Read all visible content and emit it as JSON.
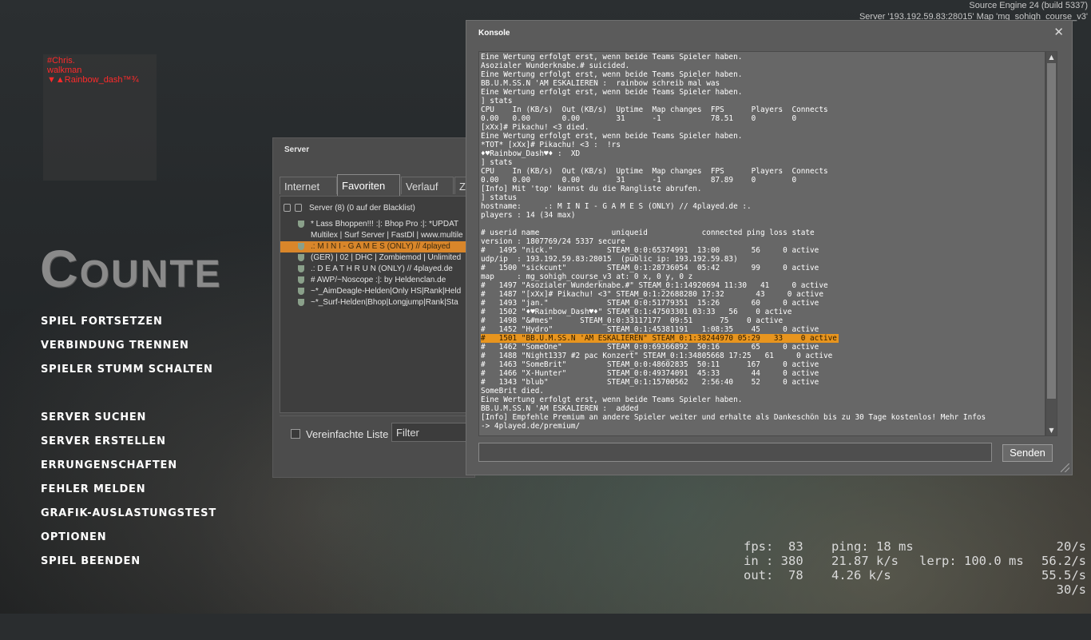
{
  "engine_info": {
    "build": "Source Engine 24 (build 5337)",
    "server_line": "Server '193.192.59.83:28015' Map 'mg_sohigh_course_v3'"
  },
  "killfeed": [
    "#Chris.",
    "walkman",
    "▼▲Rainbow_dash™¾"
  ],
  "logo": {
    "big1": "C",
    "small1": "OUNT",
    "rest": "E"
  },
  "main_menu": {
    "group1": [
      "SPIEL FORTSETZEN",
      "VERBINDUNG TRENNEN",
      "SPIELER STUMM SCHALTEN"
    ],
    "group2": [
      "SERVER SUCHEN",
      "SERVER ERSTELLEN",
      "ERRUNGENSCHAFTEN",
      "FEHLER MELDEN",
      "GRAFIK-AUSLASTUNGSTEST",
      "OPTIONEN",
      "SPIEL BEENDEN"
    ]
  },
  "server_browser": {
    "title": "Server",
    "tabs": [
      "Internet",
      "Favoriten",
      "Verlauf",
      "Z"
    ],
    "list_header": "Server (8) (0 auf der Blacklist)",
    "rows": [
      "* Lass Bhoppen!!! :|: Bhop Pro :|: *UPDAT",
      "Multilex | Surf Server | FastDl | www.multile",
      ".: M I N I - G A M E S (ONLY) // 4played",
      "(GER) | 02 | DHC | Zombiemod | Unlimited",
      ".: D E A T H R U N (ONLY) // 4played.de",
      "# AWP/~Noscope :|: by Heldenclan.de",
      "~*_AimDeagle-Helden|Only HS|Rank|Held",
      "~*_Surf-Helden|Bhop|Longjump|Rank|Sta"
    ],
    "checkbox_label": "Vereinfachte Liste",
    "filter_placeholder": "Filter"
  },
  "console": {
    "title": "Konsole",
    "close_glyph": "✕",
    "send_label": "Senden",
    "lines": [
      "Eine Wertung erfolgt erst, wenn beide Teams Spieler haben.",
      "Asozialer Wunderknabe.# suicided.",
      "Eine Wertung erfolgt erst, wenn beide Teams Spieler haben.",
      "BB.U.M.SS.N 'AM ESKALIEREN :  rainbow schreib mal was",
      "Eine Wertung erfolgt erst, wenn beide Teams Spieler haben.",
      "] stats",
      "CPU    In (KB/s)  Out (KB/s)  Uptime  Map changes  FPS      Players  Connects",
      "0.00   0.00       0.00        31      -1           78.51    0        0",
      "[xXx]# Pikachu! <3 died.",
      "Eine Wertung erfolgt erst, wenn beide Teams Spieler haben.",
      "*TOT* [xXx]# Pikachu! <3 :  !rs",
      "♦♥Rainbow_Dash♥♦ :  XD",
      "] stats",
      "CPU    In (KB/s)  Out (KB/s)  Uptime  Map changes  FPS      Players  Connects",
      "0.00   0.00       0.00        31      -1           87.89    0        0",
      "[Info] Mit 'top' kannst du die Rangliste abrufen.",
      "] status",
      "hostname:     .: M I N I - G A M E S (ONLY) // 4played.de :.",
      "players : 14 (34 max)",
      "",
      "# userid name                uniqueid            connected ping loss state",
      "version : 1807769/24 5337 secure",
      "#   1495 \"nick.\"            STEAM_0:0:65374991  13:00       56     0 active",
      "udp/ip  : 193.192.59.83:28015  (public ip: 193.192.59.83)",
      "#   1500 \"sickcunt\"         STEAM_0:1:28736054  05:42       99     0 active",
      "map     : mg_sohigh_course_v3 at: 0 x, 0 y, 0 z",
      "#   1497 \"Asozialer Wunderknabe.#\" STEAM_0:1:14920694 11:30   41     0 active",
      "#   1487 \"[xXx]# Pikachu! <3\" STEAM_0:1:22688280 17:32       43     0 active",
      "#   1493 \"jan.\"             STEAM_0:0:51779351  15:26       60     0 active",
      "#   1502 \"♦♥Rainbow_Dash♥♦\" STEAM_0:1:47503301 03:33   56    0 active",
      "#   1498 \"&#mes\"      STEAM_0:0:33117177  09:51      75    0 active",
      "#   1452 \"Hydro\"            STEAM_0:1:45381191   1:08:35    45     0 active",
      "#   1501 \"BB.U.M.SS.N 'AM ESKALIEREN\" STEAM_0:1:38244970 05:29   33    0 active",
      "#   1462 \"SomeOne\"          STEAM_0:0:69366892  50:16       65     0 active",
      "#   1488 \"Night1337 #2 pac Konzert\" STEAM_0:1:34805668 17:25   61     0 active",
      "#   1463 \"SomeBrit\"         STEAM_0:0:48602835  50:11      167     0 active",
      "#   1466 \"X-Hunter\"         STEAM_0:0:49374091  45:33       44     0 active",
      "#   1343 \"blub\"             STEAM_0:1:15700562   2:56:40    52     0 active",
      "SomeBrit died.",
      "Eine Wertung erfolgt erst, wenn beide Teams Spieler haben.",
      "BB.U.M.SS.N 'AM ESKALIEREN :  added",
      "[Info] Empfehle Premium an andere Spieler weiter und erhalte als Dankeschön bis zu 30 Tage kostenlos! Mehr Infos",
      "-> 4played.de/premium/"
    ]
  },
  "netgraph": {
    "row1": {
      "a": "fps:  83",
      "b": "ping: 18 ms",
      "c": "20/s"
    },
    "row2": {
      "a": "in : 380",
      "b": "21.87 k/s",
      "c": "lerp: 100.0 ms",
      "d": "56.2/s"
    },
    "row3": {
      "a": "out:  78",
      "b": "4.26 k/s",
      "d": "55.5/s"
    },
    "row4": {
      "d": "30/s"
    }
  }
}
